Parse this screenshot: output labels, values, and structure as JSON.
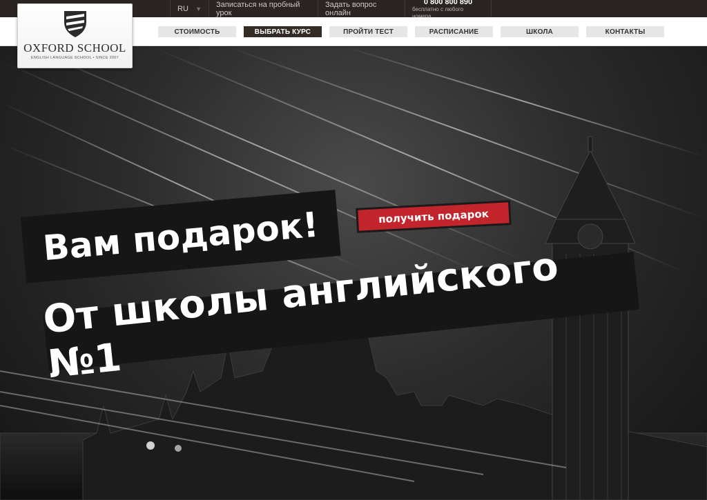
{
  "topbar": {
    "language": "RU",
    "trial_link": "Записаться на пробный урок",
    "ask_link": "Задать вопрос онлайн",
    "phone_number": "0 800 800 890",
    "phone_note": "бесплатно с любого номера"
  },
  "logo": {
    "name": "OXFORD SCHOOL",
    "tagline": "ENGLISH LANGUAGE SCHOOL • SINCE 2007"
  },
  "nav": {
    "items": [
      {
        "label": "СТОИМОСТЬ",
        "active": false
      },
      {
        "label": "ВЫБРАТЬ КУРС",
        "active": true
      },
      {
        "label": "ПРОЙТИ ТЕСТ",
        "active": false
      },
      {
        "label": "РАСПИСАНИЕ",
        "active": false
      },
      {
        "label": "ШКОЛА",
        "active": false
      },
      {
        "label": "КОНТАКТЫ",
        "active": false
      }
    ]
  },
  "hero": {
    "headline_1": "Вам подарок!",
    "headline_2": "От школы английского №1",
    "cta_label": "получить подарок"
  },
  "colors": {
    "accent_red": "#c2262c",
    "topbar_bg": "#2a2522",
    "active_nav_bg": "#332b26"
  }
}
